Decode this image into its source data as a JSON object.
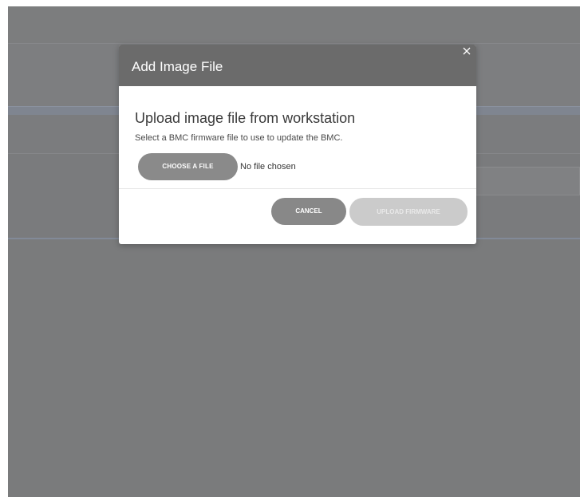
{
  "modal": {
    "title": "Add Image File",
    "close_icon": "close-icon",
    "heading": "Upload image file from workstation",
    "description": "Select a BMC firmware file to use to update the BMC.",
    "choose_file_label": "CHOOSE A FILE",
    "file_status": "No file chosen",
    "cancel_label": "CANCEL",
    "upload_label": "UPLOAD FIRMWARE",
    "upload_disabled": true
  },
  "colors": {
    "overlay": "#7a7b7c",
    "header": "#6b6b6b",
    "button_primary": "#8a8a8a",
    "button_disabled": "#cbcbcb"
  }
}
